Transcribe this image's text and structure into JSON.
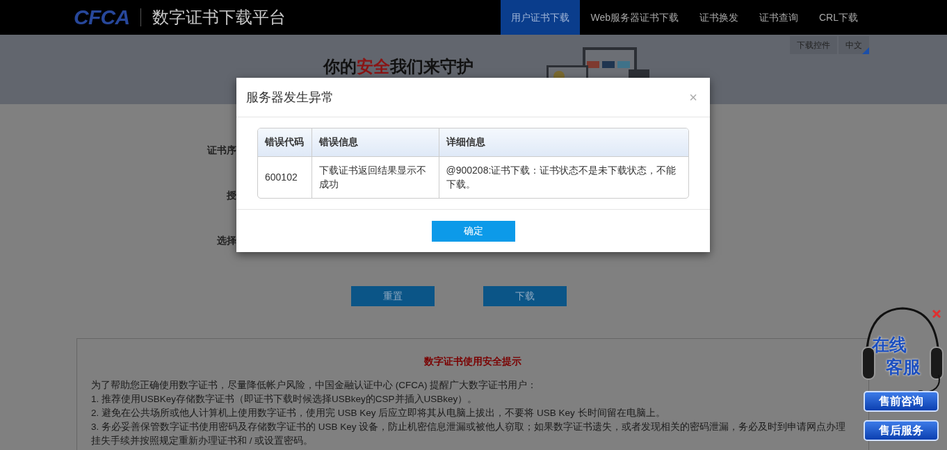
{
  "header": {
    "logo": "CFCA",
    "title": "数字证书下载平台",
    "nav": [
      {
        "label": "用户证书下载",
        "selected": true
      },
      {
        "label": "Web服务器证书下载",
        "selected": false
      },
      {
        "label": "证书换发",
        "selected": false
      },
      {
        "label": "证书查询",
        "selected": false
      },
      {
        "label": "CRL下载",
        "selected": false
      }
    ]
  },
  "banner": {
    "slogan": [
      {
        "text": "你的",
        "highlight": false
      },
      {
        "text": "安全",
        "highlight": true
      },
      {
        "text": "我们来守护",
        "highlight": false
      }
    ],
    "links": [
      "下载控件",
      "中文"
    ]
  },
  "form": {
    "labels": [
      "证书序",
      "授",
      "选择"
    ],
    "buttons": [
      "重置",
      "下载"
    ]
  },
  "notice": {
    "title": "数字证书使用安全提示",
    "lines": [
      "为了帮助您正确使用数字证书，尽量降低帐户风险，中国金融认证中心 (CFCA) 提醒广大数字证书用户：",
      "1. 推荐使用USBKey存储数字证书（即证书下载时候选择USBkey的CSP并插入USBkey）。",
      "2. 避免在公共场所或他人计算机上使用数字证书，使用完 USB Key 后应立即将其从电脑上拔出，不要将 USB Key 长时间留在电脑上。",
      "3. 务必妥善保管数字证书使用密码及存储数字证书的 USB Key 设备，防止机密信息泄漏或被他人窃取；如果数字证书遗失，或者发现相关的密码泄漏，务必及时到申请网点办理挂失手续并按照规定重新办理证书和 / 或设置密码。"
    ]
  },
  "dialog": {
    "title": "服务器发生异常",
    "close": "×",
    "columns": [
      "错误代码",
      "错误信息",
      "详细信息"
    ],
    "rows": [
      [
        "600102",
        "下载证书返回结果显示不成功",
        "@900208:证书下载：证书状态不是未下载状态，不能下载。"
      ]
    ],
    "confirm": "确定"
  },
  "service": {
    "title": [
      "在线",
      "客服"
    ],
    "buttons": [
      "售前咨询",
      "售后服务"
    ]
  }
}
